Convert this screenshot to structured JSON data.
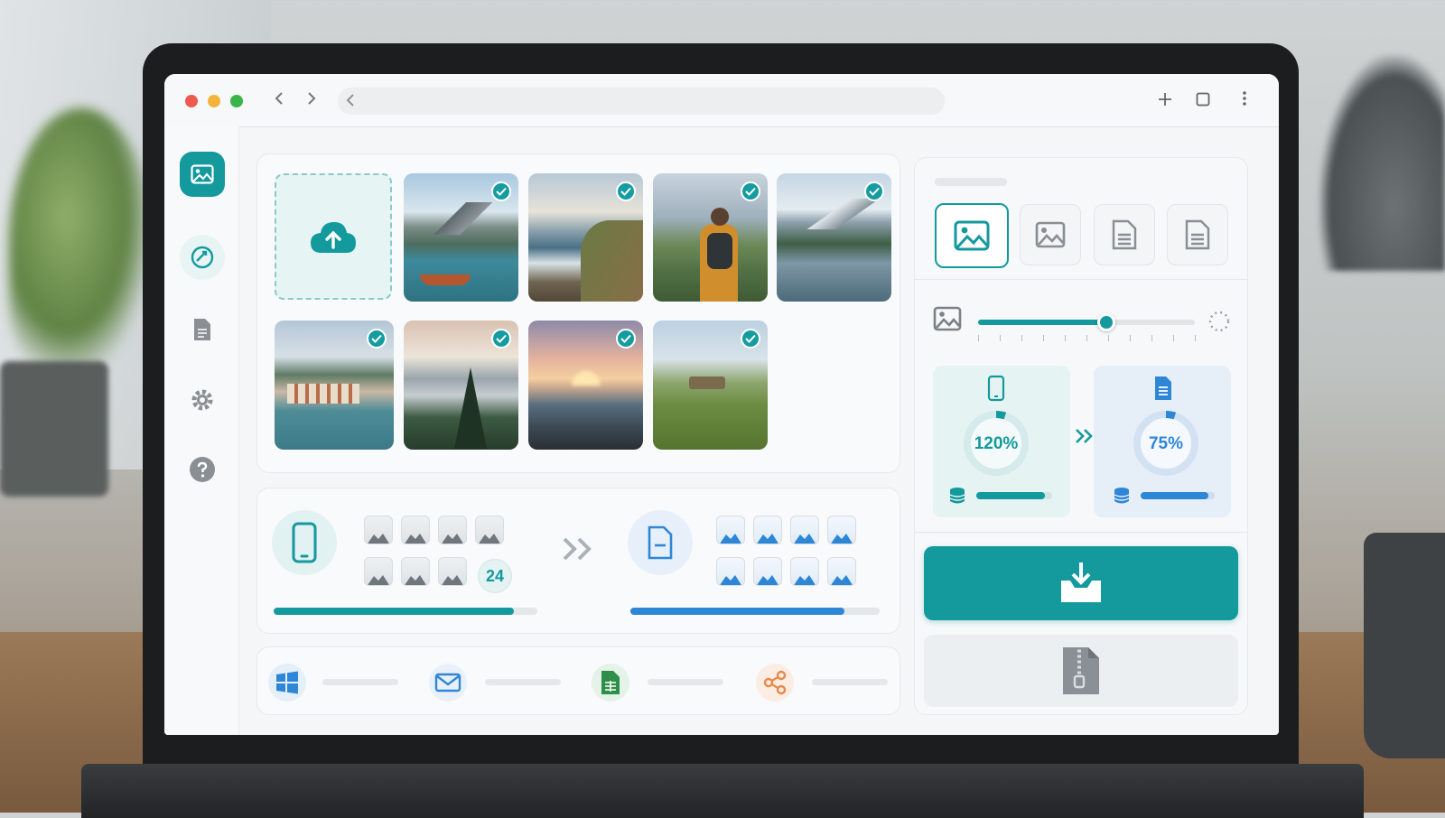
{
  "colors": {
    "accent": "#14999d",
    "blue": "#2e86d6",
    "green": "#2e8f4a",
    "orange": "#e8884a"
  },
  "converter": {
    "batch_count": "24",
    "source_progress": 0.91,
    "target_progress": 0.86
  },
  "resize": {
    "slider_value": 0.59
  },
  "compare": {
    "source_percent": "120%",
    "source_ring": 0.05,
    "source_storage": 0.9,
    "target_percent": "75%",
    "target_ring": 0.05,
    "target_storage": 0.92
  },
  "icons": {
    "upload": "cloud-upload-icon",
    "download": "download-icon",
    "zip": "zip-file-icon",
    "windows": "windows-icon",
    "mail": "mail-icon",
    "sheet": "spreadsheet-icon",
    "share": "share-icon"
  }
}
